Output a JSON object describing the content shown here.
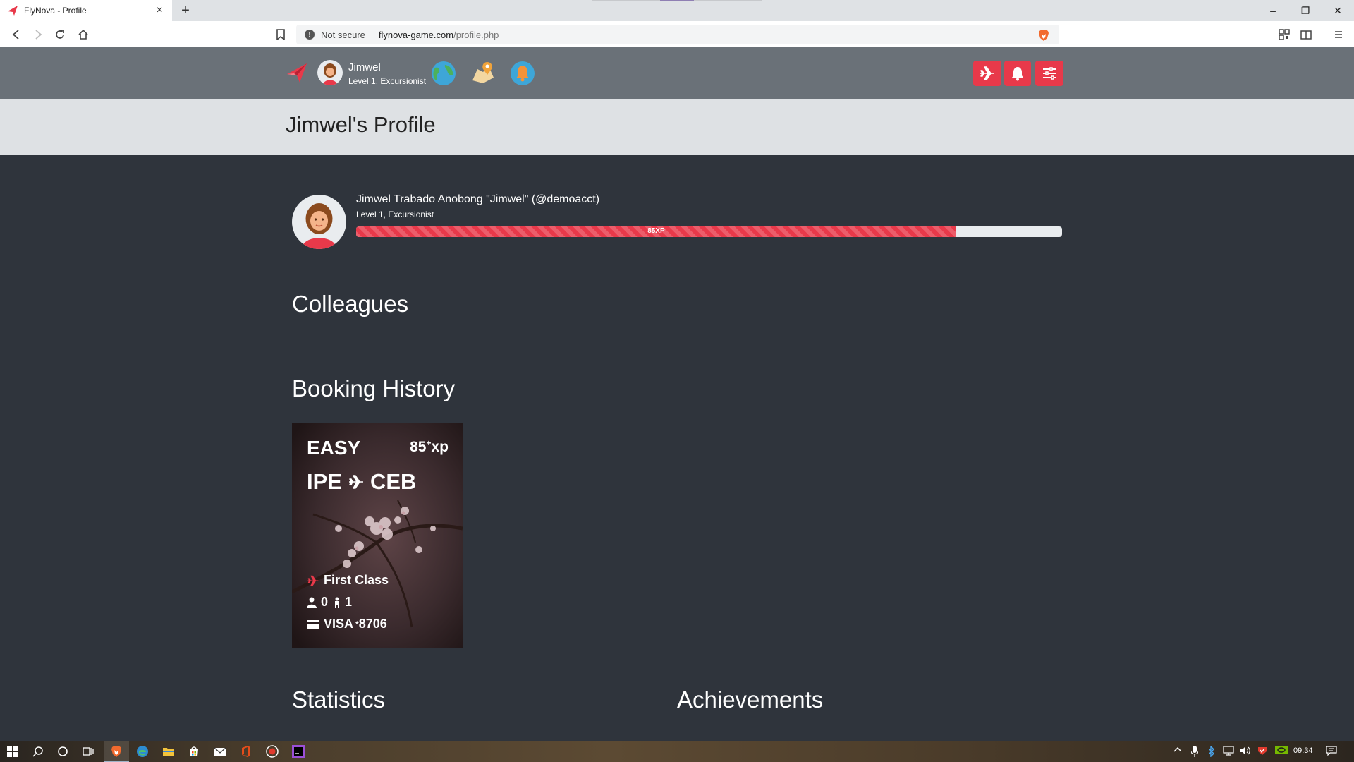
{
  "browser": {
    "tab_title": "FlyNova - Profile",
    "new_tab": "+",
    "security": "Not secure",
    "url_host": "flynova-game.com",
    "url_path": "/profile.php"
  },
  "nav": {
    "username": "Jimwel",
    "level": "Level 1, Excursionist"
  },
  "page": {
    "title": "Jimwel's Profile"
  },
  "profile": {
    "full_name": "Jimwel Trabado Anobong \"Jimwel\" (@demoacct)",
    "level": "Level 1, Excursionist",
    "xp_label": "85XP",
    "xp_progress": 0.85
  },
  "sections": {
    "colleagues": "Colleagues",
    "booking_history": "Booking History",
    "statistics": "Statistics",
    "achievements": "Achievements"
  },
  "booking": {
    "difficulty": "EASY",
    "xp_value": "85",
    "xp_sup": "+",
    "xp_unit": "xp",
    "origin": "IPE",
    "destination": "CEB",
    "class": "First Class",
    "adults": "0",
    "children": "1",
    "payment_brand": "VISA",
    "payment_sup": "*",
    "payment_last4": "8706"
  },
  "taskbar": {
    "clock": "09:34"
  },
  "colors": {
    "accent": "#e8394a",
    "navbar": "#6a7178",
    "page_bg": "#2f343c",
    "header_bg": "#dee1e4"
  }
}
